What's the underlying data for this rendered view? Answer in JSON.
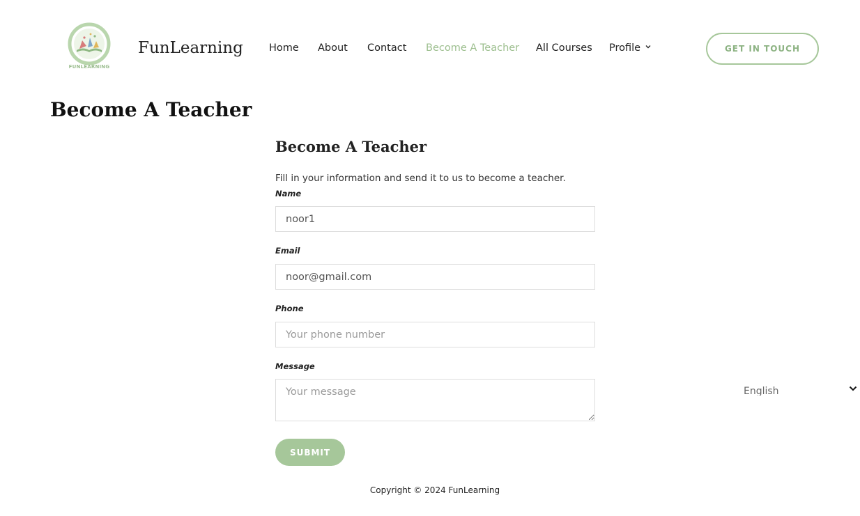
{
  "brand": {
    "name": "FunLearning",
    "logo_caption": "FUNLEARNING"
  },
  "nav": {
    "items": [
      {
        "label": "Home",
        "active": false
      },
      {
        "label": "About",
        "active": false
      },
      {
        "label": "Contact",
        "active": false
      },
      {
        "label": "Become A Teacher",
        "active": true
      },
      {
        "label": "All Courses",
        "active": false
      },
      {
        "label": "Profile",
        "active": false,
        "icon": "chevron-down-icon"
      }
    ],
    "cta_label": "GET IN TOUCH"
  },
  "page": {
    "title": "Become A Teacher"
  },
  "form": {
    "heading": "Become A Teacher",
    "description": "Fill in your information and send it to us to become a teacher.",
    "fields": {
      "name": {
        "label": "Name",
        "value": "noor1",
        "placeholder": ""
      },
      "email": {
        "label": "Email",
        "value": "noor@gmail.com",
        "placeholder": ""
      },
      "phone": {
        "label": "Phone",
        "value": "",
        "placeholder": "Your phone number"
      },
      "message": {
        "label": "Message",
        "value": "",
        "placeholder": "Your message"
      }
    },
    "submit_label": "SUBMIT"
  },
  "language_selector": {
    "selected": "English",
    "icon": "chevron-down-icon"
  },
  "footer": {
    "copyright": "Copyright © 2024 FunLearning"
  },
  "colors": {
    "accent": "#a6c79a",
    "accent_text": "#9dbf8f"
  }
}
